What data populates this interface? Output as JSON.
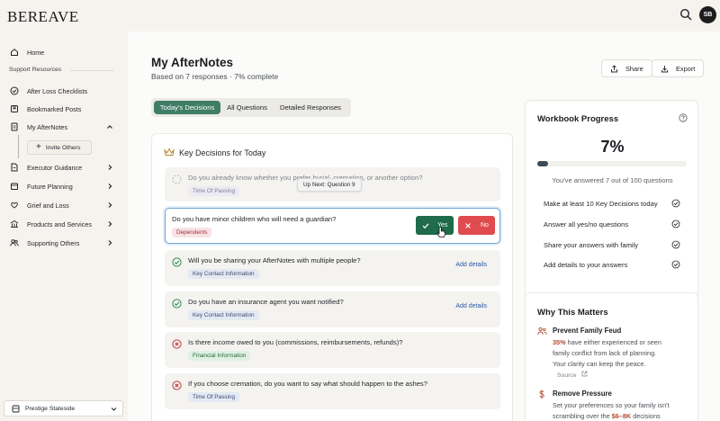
{
  "app": {
    "logo": "BEREAVE",
    "avatar_initials": "SB"
  },
  "sidebar": {
    "home": "Home",
    "section_label": "Support Resources",
    "items": [
      {
        "label": "After Loss Checklists"
      },
      {
        "label": "Bookmarked Posts"
      },
      {
        "label": "My AfterNotes"
      },
      {
        "label": "Executor Guidance"
      },
      {
        "label": "Future Planning"
      },
      {
        "label": "Grief and Loss"
      },
      {
        "label": "Products and Services"
      },
      {
        "label": "Supporting Others"
      }
    ],
    "invite_label": "Invite Others",
    "org_name": "Prestige Stateside"
  },
  "header": {
    "title": "My AfterNotes",
    "subtitle": "Based on 7 responses · 7% complete",
    "share_label": "Share",
    "export_label": "Export"
  },
  "tabs": [
    "Today's Decisions",
    "All Questions",
    "Detailed Responses"
  ],
  "decisions": {
    "title": "Key Decisions for Today",
    "tooltip": "Up Next: Question 9",
    "yes_label": "Yes",
    "no_label": "No",
    "add_details_label": "Add details",
    "questions": [
      {
        "text": "Do you already know whether you prefer burial, cremation, or another option?",
        "tag": "Time Of Passing",
        "status": "pending"
      },
      {
        "text": "Do you have minor children who will need a guardian?",
        "tag": "Dependents",
        "status": "current"
      },
      {
        "text": "Will you be sharing your AfterNotes with multiple people?",
        "tag": "Key Contact Information",
        "status": "answered-yes"
      },
      {
        "text": "Do you have an insurance agent you want notified?",
        "tag": "Key Contact Information",
        "status": "answered-yes"
      },
      {
        "text": "Is there income owed to you (commissions, reimbursements, refunds)?",
        "tag": "Financial Information",
        "status": "answered-no"
      },
      {
        "text": "If you choose cremation, do you want to say what should happen to the ashes?",
        "tag": "Time Of Passing",
        "status": "answered-no"
      }
    ]
  },
  "progress": {
    "title": "Workbook Progress",
    "percent_label": "7%",
    "percent_value": 0.07,
    "summary": "You've answered 7 out of 100 questions",
    "goals": [
      "Make at least 10 Key Decisions today",
      "Answer all yes/no questions",
      "Share your answers with family",
      "Add details to your answers"
    ]
  },
  "why": {
    "title": "Why This Matters",
    "items": [
      {
        "title": "Prevent Family Feud",
        "highlight": "35%",
        "body_line1": " have either experienced or seen",
        "body_line2": "family conflict from lack of planning.",
        "body_line3": "Your clarity can keep the peace.",
        "source": "Source"
      },
      {
        "title": "Remove Pressure",
        "body_line1": "Set your preferences so your family isn't",
        "body_pre": "scrambling over the ",
        "highlight": "$6–8K",
        "body_post": " decisions"
      }
    ]
  },
  "colors": {
    "accent_green": "#3f7d66",
    "yes_green": "#1f6b4a",
    "no_red": "#df4b4e",
    "highlight_border": "#6fa5d4",
    "link_blue": "#2b5aa6"
  }
}
